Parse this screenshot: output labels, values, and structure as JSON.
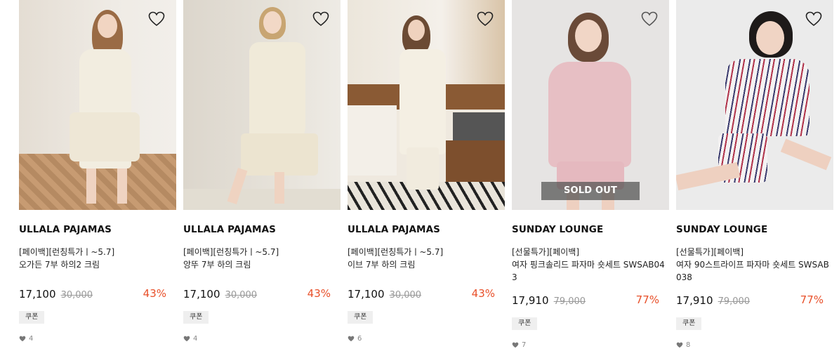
{
  "products": [
    {
      "brand": "ULLALA PAJAMAS",
      "tag": "[페이백][런칭특가ㅣ~5.7]",
      "name": "오가든 7부 하의2 크림",
      "price": "17,100",
      "original_price": "30,000",
      "discount": "43%",
      "coupon": "쿠폰",
      "likes": "4",
      "sold_out": ""
    },
    {
      "brand": "ULLALA PAJAMAS",
      "tag": "[페이백][런칭특가ㅣ~5.7]",
      "name": "앙뚜 7부 하의 크림",
      "price": "17,100",
      "original_price": "30,000",
      "discount": "43%",
      "coupon": "쿠폰",
      "likes": "4",
      "sold_out": ""
    },
    {
      "brand": "ULLALA PAJAMAS",
      "tag": "[페이백][런칭특가ㅣ~5.7]",
      "name": "이브 7부 하의 크림",
      "price": "17,100",
      "original_price": "30,000",
      "discount": "43%",
      "coupon": "쿠폰",
      "likes": "6",
      "sold_out": ""
    },
    {
      "brand": "SUNDAY LOUNGE",
      "tag": "[선물특가][페이백]",
      "name": "여자 핑크솔리드 파자마 숏세트 SWSAB043",
      "price": "17,910",
      "original_price": "79,000",
      "discount": "77%",
      "coupon": "쿠폰",
      "likes": "7",
      "sold_out": "SOLD OUT"
    },
    {
      "brand": "SUNDAY LOUNGE",
      "tag": "[선물특가][페이백]",
      "name": "여자 90스트라이프 파자마 숏세트 SWSAB038",
      "price": "17,910",
      "original_price": "79,000",
      "discount": "77%",
      "coupon": "쿠폰",
      "likes": "8",
      "sold_out": ""
    }
  ],
  "colors": {
    "discount": "#e8502a",
    "coupon_bg": "#efefef",
    "sold_out_bg": "#505050"
  },
  "icons": {
    "wishlist": "heart-outline-icon",
    "likes": "heart-filled-icon"
  }
}
